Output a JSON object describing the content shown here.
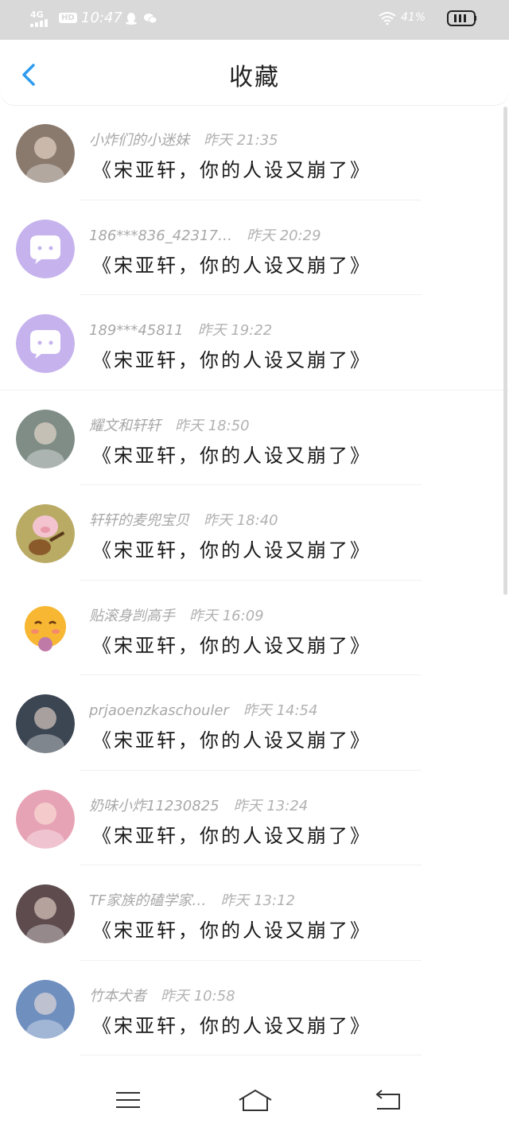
{
  "status_bar": {
    "network": "4G",
    "hd": "HD",
    "time": "10:47",
    "battery_percent": "41%",
    "icons": [
      "signal-icon",
      "qq-icon",
      "wechat-icon",
      "wifi-icon",
      "battery-icon"
    ]
  },
  "header": {
    "title": "收藏",
    "back_icon": "chevron-left-icon",
    "accent_color": "#2e9bf0"
  },
  "favorites": [
    {
      "user": "小炸们的小迷妹",
      "time": "昨天 21:35",
      "message": "《宋亚轩，你的人设又崩了》",
      "avatar": "photo-boy",
      "avatar_color": "#8a7a6e"
    },
    {
      "user": "186***836_42317…",
      "time": "昨天 20:29",
      "message": "《宋亚轩，你的人设又崩了》",
      "avatar": "default-chat",
      "avatar_color": "#c6b3ee"
    },
    {
      "user": "189***45811",
      "time": "昨天 19:22",
      "message": "《宋亚轩，你的人设又崩了》",
      "avatar": "default-chat",
      "avatar_color": "#c6b3ee"
    },
    {
      "user": "耀文和轩轩",
      "time": "昨天 18:50",
      "message": "《宋亚轩，你的人设又崩了》",
      "avatar": "photo-group",
      "avatar_color": "#7f8d86"
    },
    {
      "user": "轩轩的麦兜宝贝",
      "time": "昨天 18:40",
      "message": "《宋亚轩，你的人设又崩了》",
      "avatar": "pig-guitar",
      "avatar_color": "#b9aa64"
    },
    {
      "user": "贴滚身剀高手",
      "time": "昨天 16:09",
      "message": "《宋亚轩，你的人设又崩了》",
      "avatar": "emoji-blush",
      "avatar_color": "#f7b733"
    },
    {
      "user": "prjaoenzkaschouler",
      "time": "昨天 14:54",
      "message": "《宋亚轩，你的人设又崩了》",
      "avatar": "photo-ape",
      "avatar_color": "#3c4552"
    },
    {
      "user": "奶味小炸11230825",
      "time": "昨天 13:24",
      "message": "《宋亚轩，你的人设又崩了》",
      "avatar": "photo-pink-group",
      "avatar_color": "#e7a3b6"
    },
    {
      "user": "TF家族的磕学家…",
      "time": "昨天 13:12",
      "message": "《宋亚轩，你的人设又崩了》",
      "avatar": "photo-girl",
      "avatar_color": "#5d4b4e"
    },
    {
      "user": "竹本犬者",
      "time": "昨天 10:58",
      "message": "《宋亚轩，你的人设又崩了》",
      "avatar": "photo-anime",
      "avatar_color": "#6f8fbf"
    }
  ],
  "nav_bar": {
    "icons": [
      "menu-icon",
      "home-icon",
      "back-icon"
    ]
  }
}
